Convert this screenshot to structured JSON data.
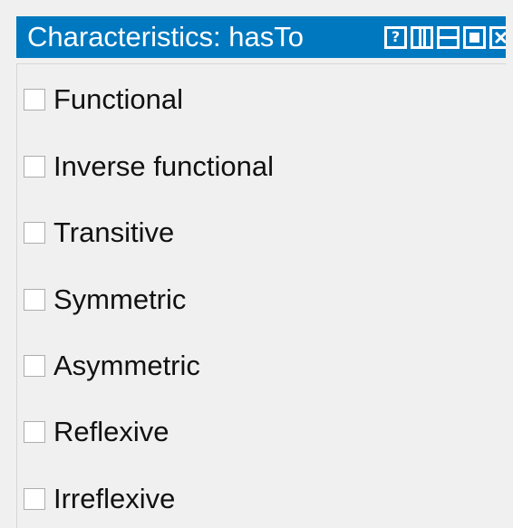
{
  "window": {
    "title": "Characteristics: hasTo",
    "buttons": [
      {
        "name": "help",
        "icon": "help-icon",
        "glyph": "?"
      },
      {
        "name": "split-vertical",
        "icon": "split-vertical-icon"
      },
      {
        "name": "split-horizontal",
        "icon": "split-horizontal-icon"
      },
      {
        "name": "maximize",
        "icon": "maximize-icon"
      },
      {
        "name": "close",
        "icon": "close-icon"
      }
    ]
  },
  "characteristics": [
    {
      "label": "Functional",
      "checked": false
    },
    {
      "label": "Inverse functional",
      "checked": false
    },
    {
      "label": "Transitive",
      "checked": false
    },
    {
      "label": "Symmetric",
      "checked": false
    },
    {
      "label": "Asymmetric",
      "checked": false
    },
    {
      "label": "Reflexive",
      "checked": false
    },
    {
      "label": "Irreflexive",
      "checked": false
    }
  ],
  "colors": {
    "titlebar": "#0078bf",
    "title_text": "#ffffff",
    "panel_bg": "#f0f0f0",
    "checkbox_border": "#adadad",
    "label_text": "#111111"
  }
}
